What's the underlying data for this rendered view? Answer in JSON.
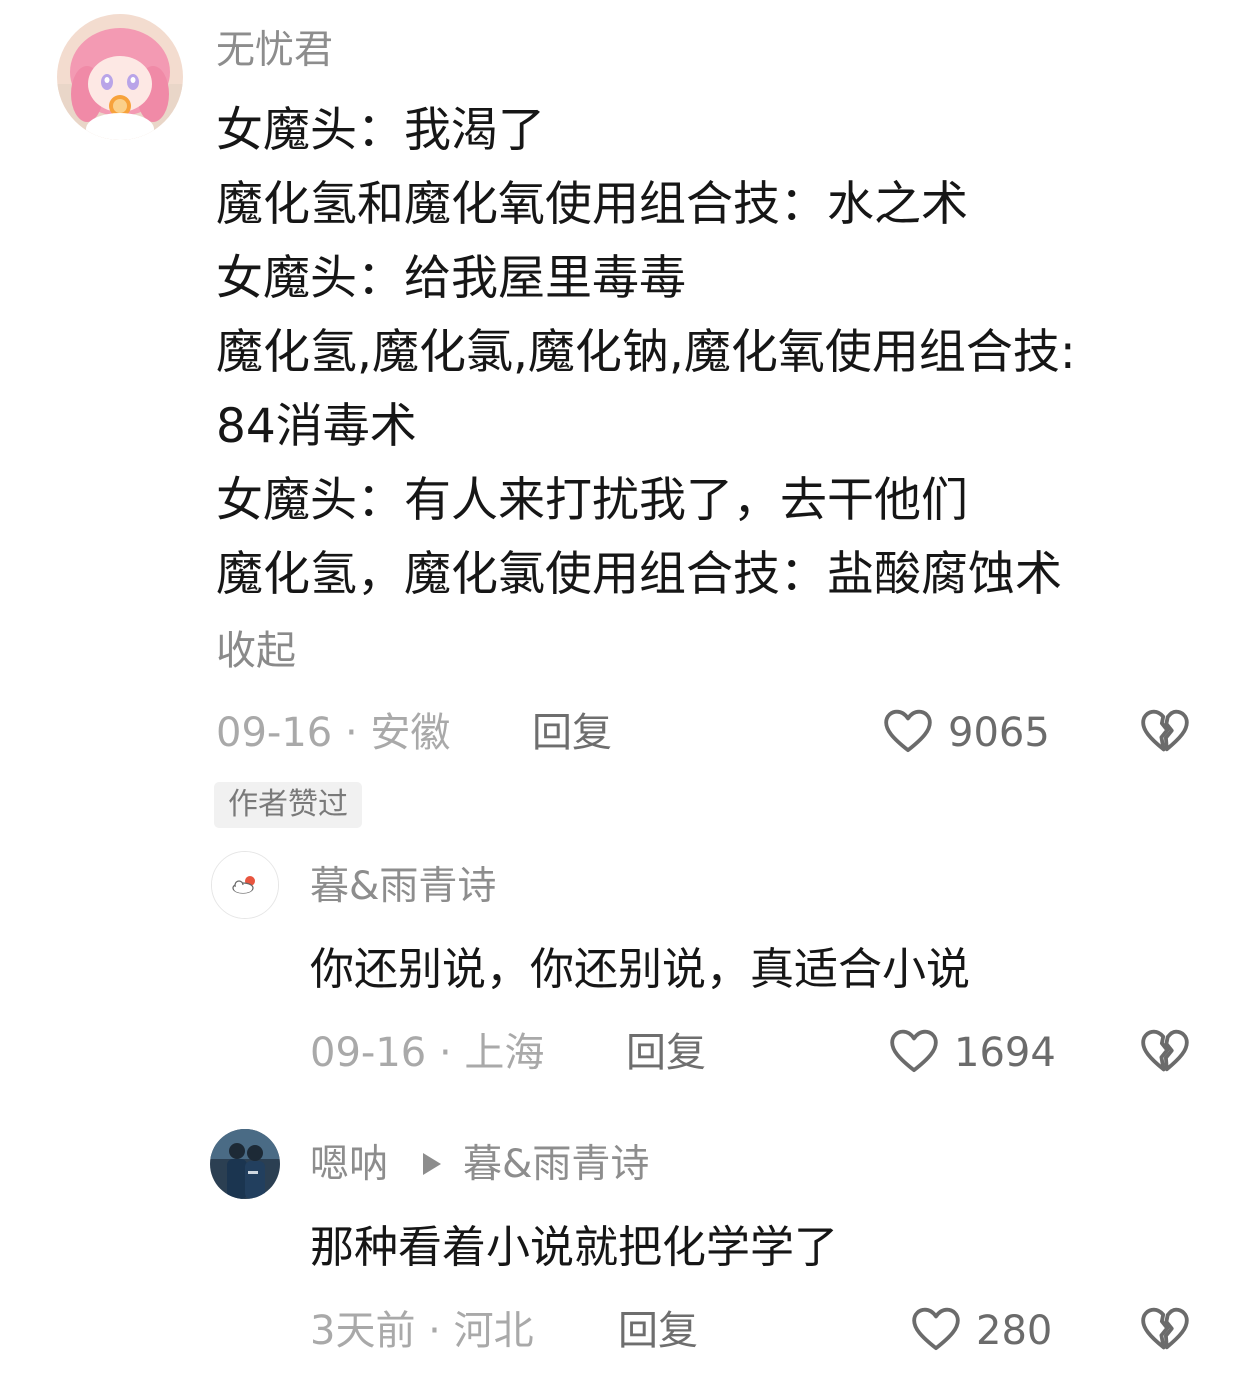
{
  "main_comment": {
    "username": "无忧君",
    "lines": [
      "女魔头：我渴了",
      "魔化氢和魔化氧使用组合技：水之术",
      "女魔头：给我屋里毒毒",
      "魔化氢,魔化氯,魔化钠,魔化氧使用组合技:",
      "84消毒术",
      "女魔头：有人来打扰我了，去干他们",
      "魔化氢，魔化氯使用组合技：盐酸腐蚀术"
    ],
    "collapse_label": "收起",
    "meta": "09-16 · 安徽",
    "reply_label": "回复",
    "like_count": "9065",
    "author_liked_badge": "作者赞过"
  },
  "replies": [
    {
      "username": "暮&雨青诗",
      "text": "你还别说，你还别说，真适合小说",
      "meta": "09-16 · 上海",
      "reply_label": "回复",
      "like_count": "1694"
    },
    {
      "username": "嗯呐",
      "reply_to": "暮&雨青诗",
      "text": "那种看着小说就把化学学了",
      "meta": "3天前 · 河北",
      "reply_label": "回复",
      "like_count": "280"
    }
  ],
  "icons": {
    "like": "heart-outline-icon",
    "dislike": "broken-heart-icon",
    "reply_arrow": "play-triangle-icon"
  },
  "colors": {
    "text_primary": "#161616",
    "text_secondary": "#8d8d8d",
    "text_meta": "#a9a9a9",
    "badge_bg": "#f1f1f1"
  }
}
